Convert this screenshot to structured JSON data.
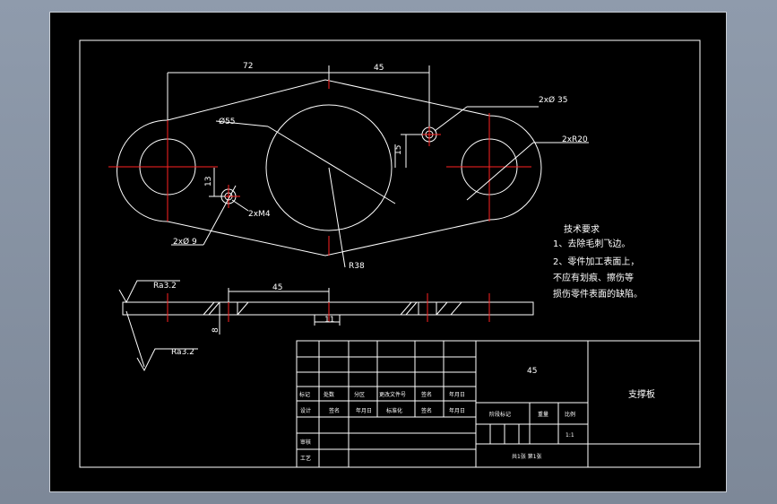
{
  "colors": {
    "background": "#000000",
    "lines": "#ffffff",
    "centerlines": "#ff2222",
    "app_backdrop": "#8f9bac"
  },
  "dims": {
    "d72": "72",
    "d45_top": "45",
    "d55": "Ø55",
    "d2x035": "2xØ 35",
    "d2xR20": "2xR20",
    "d15": "15",
    "d13": "13",
    "d2xM4": "2xM4",
    "d2x09": "2xØ 9",
    "dR38": "R38",
    "d45_side": "45",
    "d11": "11",
    "d8": "8"
  },
  "roughness": {
    "ra1": "Ra3.2",
    "ra2": "Ra3.2"
  },
  "notes": {
    "title": "技术要求",
    "line1": "1、去除毛刺飞边。",
    "line2": "2、零件加工表面上，",
    "line3": "不应有划痕、擦伤等",
    "line4": "损伤零件表面的缺陷。"
  },
  "title_block": {
    "material": "45",
    "part_name": "支撑板",
    "row_biaoji": "标记",
    "row_chushu": "处数",
    "row_fenqu": "分区",
    "row_wenjian": "更改文件号",
    "row_qianming": "签名",
    "row_riqi": "年月日",
    "sheji": "设计",
    "qianming2": "签名",
    "nianyueri2": "年月日",
    "biaozhunhua": "标准化",
    "qianming3": "签名",
    "nianyueri3": "年月日",
    "jieduan": "阶段标记",
    "zhongliang": "重量",
    "bili": "比例",
    "scale": "1:1",
    "shenhe": "审核",
    "gongyi": "工艺",
    "gongzhang": "共1张  第1张"
  }
}
